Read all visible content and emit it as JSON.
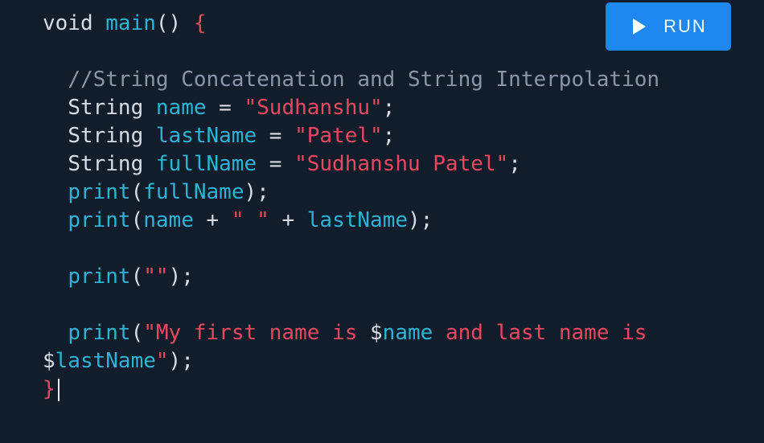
{
  "toolbar": {
    "run_label": "RUN"
  },
  "code": {
    "l1_kw": "void ",
    "l1_fn": "main",
    "l1_parens": "() ",
    "l1_brace": "{",
    "comment": "//String Concatenation and String Interpolation",
    "l4_type": "String ",
    "l4_var": "name",
    "l4_eq": " = ",
    "l4_str": "\"Sudhanshu\"",
    "l4_end": ";",
    "l5_type": "String ",
    "l5_var": "lastName",
    "l5_eq": " = ",
    "l5_str": "\"Patel\"",
    "l5_end": ";",
    "l6_type": "String ",
    "l6_var": "fullName",
    "l6_eq": " = ",
    "l6_str": "\"Sudhanshu Patel\"",
    "l6_end": ";",
    "l7_fn": "print",
    "l7_open": "(",
    "l7_arg": "fullName",
    "l7_close": ");",
    "l8_fn": "print",
    "l8_open": "(",
    "l8_a": "name",
    "l8_plus1": " + ",
    "l8_str": "\" \"",
    "l8_plus2": " + ",
    "l8_b": "lastName",
    "l8_close": ");",
    "l10_fn": "print",
    "l10_open": "(",
    "l10_str": "\"\"",
    "l10_close": ");",
    "l12_fn": "print",
    "l12_open": "(",
    "l12_str1": "\"My first name is ",
    "l12_dollar": "$",
    "l12_var": "name",
    "l12_str2": " and last name is",
    "l13_dollar": "$",
    "l13_var": "lastName",
    "l13_str": "\"",
    "l13_close": ");",
    "l14_brace": "}"
  }
}
